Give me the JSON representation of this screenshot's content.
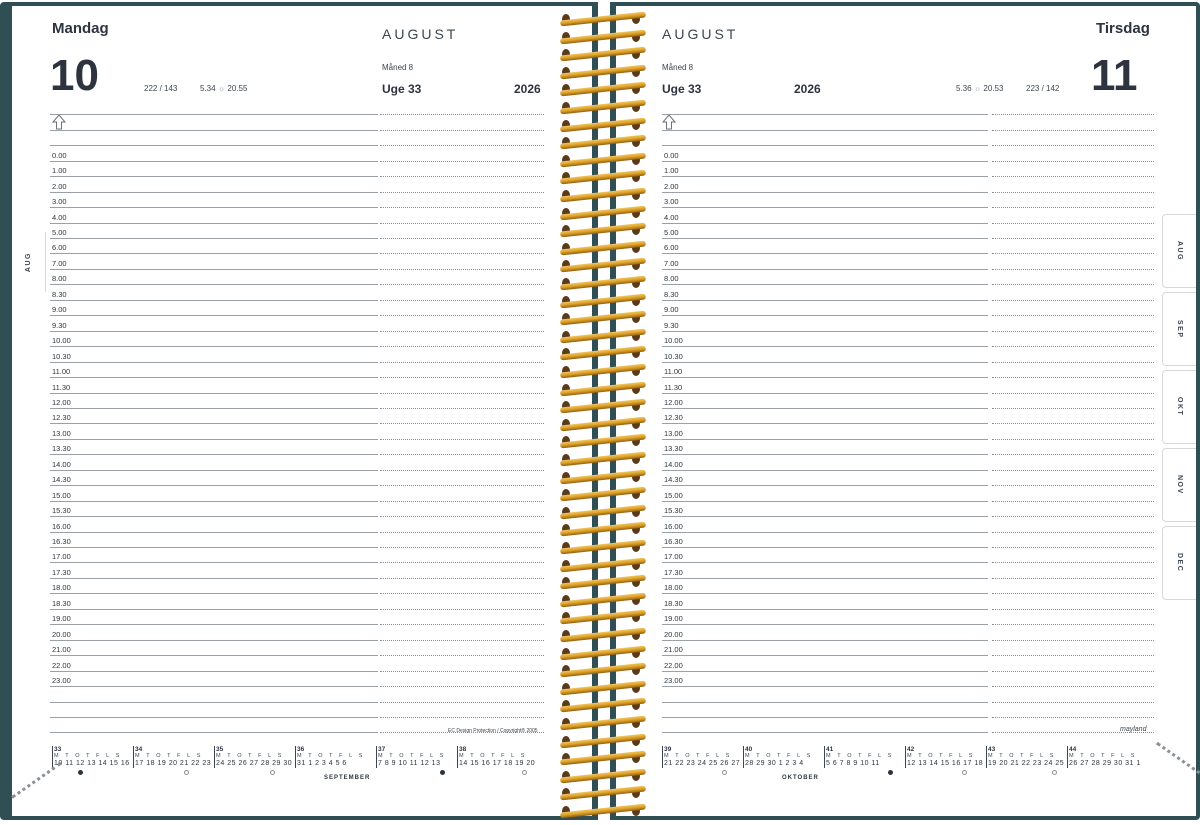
{
  "left": {
    "weekday": "Mandag",
    "day": "10",
    "day_count": "222 / 143",
    "sun": "5.34",
    "sunset": "20.55",
    "month": "AUGUST",
    "month_no": "Måned 8",
    "week": "Uge 33",
    "year": "2026",
    "footer": "EC Design Protection / Copyright® 2005",
    "mini_month": "SEPTEMBER",
    "tab": "AUG"
  },
  "right": {
    "weekday": "Tirsdag",
    "day": "11",
    "day_count": "223 / 142",
    "sun": "5.36",
    "sunset": "20.53",
    "month": "AUGUST",
    "month_no": "Måned 8",
    "week": "Uge 33",
    "year": "2026",
    "logo": "mayland",
    "mini_month": "OKTOBER",
    "tabs": [
      "AUG",
      "SEP",
      "OKT",
      "NOV",
      "DEC"
    ]
  },
  "hours": [
    "0.00",
    "1.00",
    "2.00",
    "3.00",
    "4.00",
    "5.00",
    "6.00",
    "7.00",
    "8.00",
    "8.30",
    "9.00",
    "9.30",
    "10.00",
    "10.30",
    "11.00",
    "11.30",
    "12.00",
    "12.30",
    "13.00",
    "13.30",
    "14.00",
    "14.30",
    "15.00",
    "15.30",
    "16.00",
    "16.30",
    "17.00",
    "17.30",
    "18.00",
    "18.30",
    "19.00",
    "20.00",
    "21.00",
    "22.00",
    "23.00"
  ],
  "mini_left": [
    {
      "week": "33",
      "days": "M T O T F L S",
      "dates": "10 11 12 13 14 15 16"
    },
    {
      "week": "34",
      "days": "M T O T F L S",
      "dates": "17 18 19 20 21 22 23"
    },
    {
      "week": "35",
      "days": "M T O T F L S",
      "dates": "24 25 26 27 28 29 30"
    },
    {
      "week": "36",
      "days": "M T O T F L S",
      "dates": "31 1 2 3 4 5 6"
    },
    {
      "week": "37",
      "days": "M T O T F L S",
      "dates": "7 8 9 10 11 12 13"
    },
    {
      "week": "38",
      "days": "M T O T F L S",
      "dates": "14 15 16 17 18 19 20"
    }
  ],
  "mini_right": [
    {
      "week": "39",
      "days": "M T O T F L S",
      "dates": "21 22 23 24 25 26 27"
    },
    {
      "week": "40",
      "days": "M T O T F L S",
      "dates": "28 29 30 1 2 3 4"
    },
    {
      "week": "41",
      "days": "M T O T F L S",
      "dates": "5 6 7 8 9 10 11"
    },
    {
      "week": "42",
      "days": "M T O T F L S",
      "dates": "12 13 14 15 16 17 18"
    },
    {
      "week": "43",
      "days": "M T O T F L S",
      "dates": "19 20 21 22 23 24 25"
    },
    {
      "week": "44",
      "days": "M T O T F L S",
      "dates": "26 27 28 29 30 31 1"
    }
  ],
  "colors": {
    "cover": "#2f4f55",
    "ink": "#2d3440",
    "coil": "#d79a22",
    "sunday": "#c0243a"
  }
}
